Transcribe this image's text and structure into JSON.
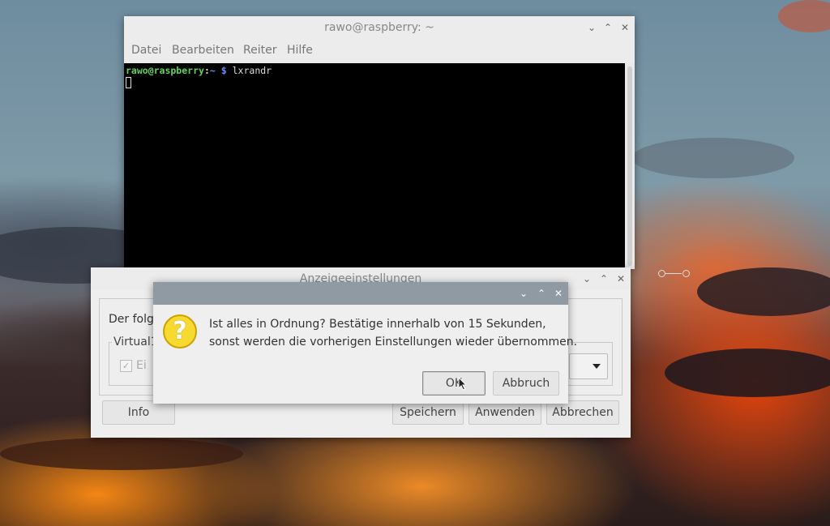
{
  "terminal_window": {
    "title": "rawo@raspberry: ~",
    "menu": [
      "Datei",
      "Bearbeiten",
      "Reiter",
      "Hilfe"
    ],
    "prompt_user": "rawo@raspberry",
    "prompt_sep": ":",
    "prompt_path": "~",
    "prompt_symbol": "$",
    "command": "lxrandr"
  },
  "display_settings": {
    "title": "Anzeigeeinstellungen",
    "text_fragment": "Der folg",
    "group_label": "Virtual1",
    "checkbox_fragment": "Ei",
    "info_button": "Info",
    "save_button": "Speichern",
    "apply_button": "Anwenden",
    "cancel_button": "Abbrechen"
  },
  "confirm_dialog": {
    "line1": "Ist alles in Ordnung? Bestätige innerhalb von 15 Sekunden,",
    "line2": "sonst werden die vorherigen Einstellungen wieder übernommen.",
    "ok_button": "OK",
    "abort_button": "Abbruch",
    "icon": "question-icon"
  },
  "window_controls": {
    "minimize": "⌄",
    "maximize": "⌃",
    "close": "✕"
  }
}
